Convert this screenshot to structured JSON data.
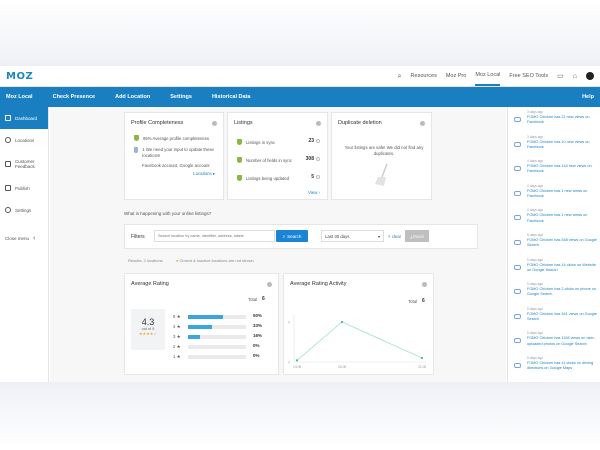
{
  "brand": {
    "logo": "MOZ",
    "accent": "#1a7fc1"
  },
  "top_nav": [
    "Resources",
    "Moz Pro",
    "Moz Local",
    "Free SEO Tools"
  ],
  "top_icons": [
    "search-icon",
    "chat-icon",
    "home-icon",
    "user-avatar-icon"
  ],
  "nav": {
    "items": [
      "Moz Local",
      "Check Presence",
      "Add Location",
      "Settings",
      "Historical Data"
    ],
    "help": "Help"
  },
  "sidebar": {
    "items": [
      "Dashboard",
      "Locations",
      "Customer Feedback",
      "Publish",
      "Settings"
    ],
    "close": "Close menu"
  },
  "profile": {
    "title": "Profile Completeness",
    "line1": "95% Average profile completeness",
    "line2": "1 We need your input to update these locations!",
    "line3": "Facebook account, Google account",
    "link": "Locations ▸"
  },
  "listings": {
    "title": "Listings",
    "rows": [
      {
        "label": "Listings in sync",
        "value": "23"
      },
      {
        "label": "Number of fields in sync",
        "value": "308"
      },
      {
        "label": "Listings being updated",
        "value": "5"
      }
    ],
    "link": "View ›"
  },
  "duplicate": {
    "title": "Duplicate deletion",
    "text": "Your listings are safe! We did not find any duplicates."
  },
  "question": "What is happening with your online listings?",
  "filters": {
    "label": "Filters",
    "placeholder": "Search location by name, identifier, address, labels",
    "search": "Search",
    "period": "Last 30 days",
    "clear": "clear",
    "export": "Excel",
    "results": "Results: 2 locations",
    "note": "Closed & inactive locations are not shown"
  },
  "avg_rating": {
    "title": "Average Rating",
    "total_label": "Total",
    "total": "6",
    "score": "4.3",
    "out_of": "out of 5",
    "stars": "★★★★☆",
    "rows": [
      {
        "label": "5 ★",
        "fraction": 0.5,
        "pct": "50%"
      },
      {
        "label": "4 ★",
        "fraction": 0.33,
        "pct": "33%"
      },
      {
        "label": "3 ★",
        "fraction": 0.16,
        "pct": "16%"
      },
      {
        "label": "2 ★",
        "fraction": 0.0,
        "pct": "0%"
      },
      {
        "label": "1 ★",
        "fraction": 0.0,
        "pct": "0%"
      }
    ]
  },
  "activity": {
    "title": "Average Rating Activity",
    "total_label": "Total",
    "total": "6",
    "chart_data": {
      "type": "line",
      "x": [
        "14.05",
        "",
        "28.05",
        "",
        "",
        "",
        "",
        "",
        "",
        "",
        "",
        "22.05"
      ],
      "y": [
        0.2,
        5,
        0.5
      ],
      "ylim": [
        0,
        6
      ],
      "yticks": [
        "5",
        "0"
      ]
    }
  },
  "feed": [
    {
      "ago": "3 days ago",
      "text": "FOMO Chicken has 21 new views on Facebook"
    },
    {
      "ago": "3 days ago",
      "text": "FOMO Chicken has 10 new views on Facebook"
    },
    {
      "ago": "4 days ago",
      "text": "FOMO Chicken has 144 new views on Facebook"
    },
    {
      "ago": "4 days ago",
      "text": "FOMO Chicken has 1 new views on Facebook"
    },
    {
      "ago": "4 days ago",
      "text": "FOMO Chicken has 1 new views on Facebook"
    },
    {
      "ago": "5 days ago",
      "text": "FOMO Chicken has 548 views on Google Search"
    },
    {
      "ago": "5 days ago",
      "text": "FOMO Chicken has 14 clicks on Website on Google Search"
    },
    {
      "ago": "5 days ago",
      "text": "FOMO Chicken has 2 clicks on phone on Google Search"
    },
    {
      "ago": "5 days ago",
      "text": "FOMO Chicken has 341 views on Google Search"
    },
    {
      "ago": "5 days ago",
      "text": "FOMO Chicken has 1156 views on user-uploaded photos on Google Search"
    },
    {
      "ago": "5 days ago",
      "text": "FOMO Chicken has 11 clicks on driving directions on Google Maps"
    }
  ]
}
